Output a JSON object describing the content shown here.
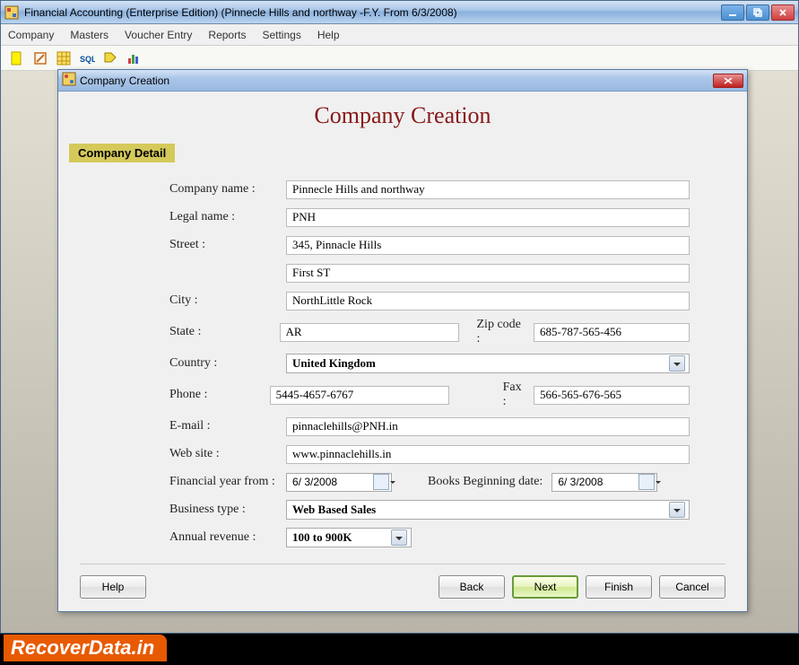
{
  "appTitle": "Financial Accounting (Enterprise Edition) (Pinnecle Hills and northway -F.Y. From 6/3/2008)",
  "menu": {
    "company": "Company",
    "masters": "Masters",
    "voucher": "Voucher Entry",
    "reports": "Reports",
    "settings": "Settings",
    "help": "Help"
  },
  "dialog": {
    "title": "Company Creation",
    "pageTitle": "Company Creation",
    "section": "Company Detail"
  },
  "labels": {
    "companyName": "Company name :",
    "legalName": "Legal name :",
    "street": "Street :",
    "city": "City :",
    "state": "State :",
    "zip": "Zip code :",
    "country": "Country :",
    "phone": "Phone :",
    "fax": "Fax :",
    "email": "E-mail :",
    "website": "Web site :",
    "fyFrom": "Financial year from :",
    "booksBegin": "Books Beginning date:",
    "businessType": "Business type :",
    "annualRevenue": "Annual revenue :"
  },
  "values": {
    "companyName": "Pinnecle Hills and northway",
    "legalName": "PNH",
    "street1": "345, Pinnacle Hills",
    "street2": "First ST",
    "city": "NorthLittle Rock",
    "state": "AR",
    "zip": "685-787-565-456",
    "country": "United Kingdom",
    "phone": "5445-4657-6767",
    "fax": "566-565-676-565",
    "email": "pinnaclehills@PNH.in",
    "website": "www.pinnaclehills.in",
    "fyFrom": "6/ 3/2008",
    "booksBegin": "6/ 3/2008",
    "businessType": "Web Based Sales",
    "annualRevenue": "100 to 900K"
  },
  "buttons": {
    "help": "Help",
    "back": "Back",
    "next": "Next",
    "finish": "Finish",
    "cancel": "Cancel"
  },
  "watermark": "RecoverData.in"
}
